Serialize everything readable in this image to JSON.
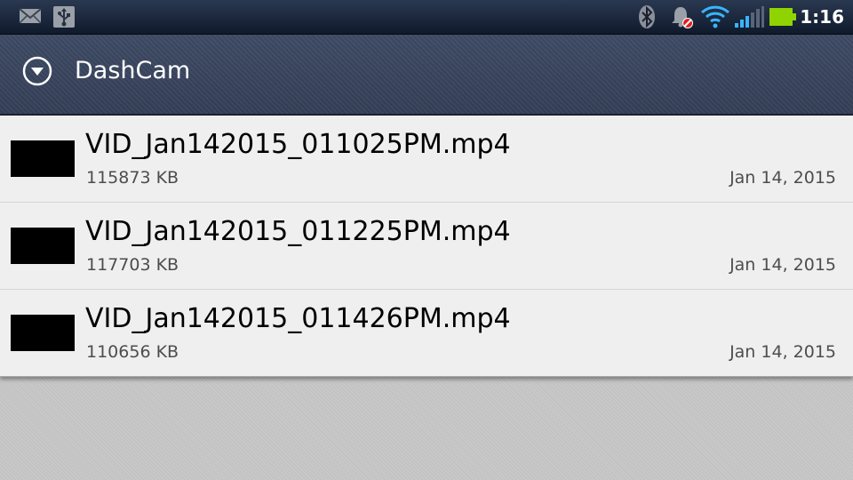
{
  "status_bar": {
    "time": "1:16",
    "left_icons": [
      "gmail-icon",
      "usb-icon"
    ],
    "right_icons": [
      "bluetooth-icon",
      "notifications-muted-icon",
      "wifi-icon",
      "signal-icon",
      "battery-icon"
    ]
  },
  "action_bar": {
    "title": "DashCam",
    "icon": "dropdown-circle-icon"
  },
  "files": [
    {
      "name": "VID_Jan142015_011025PM.mp4",
      "size": "115873 KB",
      "date": "Jan 14, 2015"
    },
    {
      "name": "VID_Jan142015_011225PM.mp4",
      "size": "117703 KB",
      "date": "Jan 14, 2015"
    },
    {
      "name": "VID_Jan142015_011426PM.mp4",
      "size": "110656 KB",
      "date": "Jan 14, 2015"
    }
  ],
  "colors": {
    "status_bar": "#0f1a2c",
    "action_bar": "#3a4660",
    "list_bg": "#efefef",
    "battery": "#8fd400",
    "wifi": "#38b4ff"
  }
}
